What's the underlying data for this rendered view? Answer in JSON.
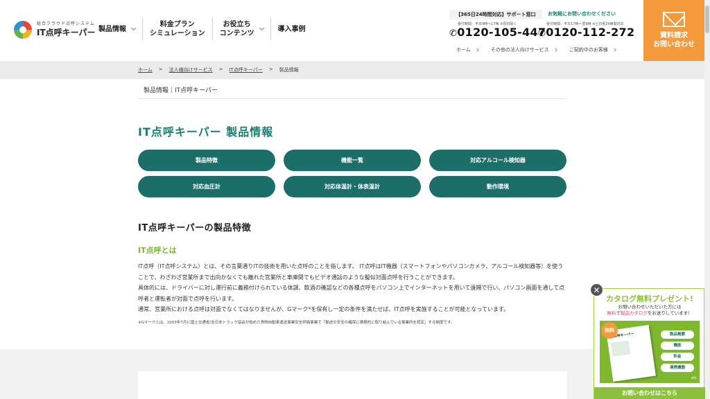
{
  "header": {
    "logo_sub": "総合クラウド点呼システム",
    "logo_main": "IT点呼キーパー",
    "nav": [
      {
        "label": "製品情報"
      },
      {
        "label_line1": "料金プラン",
        "label_line2": "シミュレーション"
      },
      {
        "label_line1": "お役立ち",
        "label_line2": "コンテンツ"
      },
      {
        "label": "導入事例"
      }
    ],
    "support_label": "【365日24時間対応】サポート窓口",
    "support_cta": "お気軽にお問い合わせください",
    "tel1_note": "受付時間：平日9時〜17時 ※祝日除く",
    "tel1_number": "0120-105-447",
    "tel2_note": "受付時間：平日17時〜翌9時 ※土日祝24時間対応",
    "tel2_number": "0120-112-272",
    "sub_links": [
      "ホーム",
      "その他の法人向けサービス",
      "ご契約中のお客様"
    ],
    "contact_line1": "資料請求",
    "contact_line2": "お問い合わせ"
  },
  "breadcrumb": {
    "items": [
      "ホーム",
      "法人様向けサービス",
      "IT点呼キーパー"
    ],
    "current": "製品情報",
    "separator": ">"
  },
  "page": {
    "subtitle": "製品情報｜IT点呼キーパー",
    "title": "IT点呼キーパー 製品情報",
    "buttons": [
      "製品特徴",
      "機能一覧",
      "対応アルコール検知器",
      "対応血圧計",
      "対応体温計・体表温計",
      "動作環境"
    ],
    "section_heading": "IT点呼キーパーの製品特徴",
    "sub_heading": "IT点呼とは",
    "paragraphs": [
      "IT点呼（IT点呼システム）とは、その言葉通りITの技術を用いた点呼のことを指します。 IT点呼はIT機器（スマートフォンやパソコンカメラ、アルコール検知器等）を使うことで、わざわざ営業所まで出向かなくても離れた営業所と車庫間でもビデオ通話のような擬似対面点呼を行うことができます。",
      "具体的には、ドライバーに対し運行前に義務付けられている体調、飲酒の確認などの各種点呼をパソコン上でインターネットを用いて遠隔で行い、パソコン画面を通して点呼者と運転者が対面で点呼を行います。",
      "通常、営業所における点呼は対面でなくてはなりませんが、Gマーク*を保有し一定の条件を満たせば、IT点呼を実施することが可能となっています。"
    ],
    "note": "※Gマークとは、2003年7月に国土交通省/全日本トラック協会が始めた貨物自動車運送事業安全評価事業で「輸送の安全の確保に積極的に取り組んでいる事業所を認定」する制度です。"
  },
  "catalog": {
    "close": "✕",
    "title": "カタログ無料プレゼント!",
    "desc_line1": "お問い合わせいただいた方には",
    "desc_em1": "無料",
    "desc_mid": "で",
    "desc_em2": "製品カタログ",
    "desc_end": "をお送りしています！",
    "badge": "無料",
    "book_title": "IT点呼キーパー",
    "tags": [
      "製品概要",
      "機能",
      "料金",
      "連携機器"
    ],
    "etc": "etc",
    "button": "お問い合わせはこちら"
  },
  "colors": {
    "accent": "#1c6f68",
    "title_green": "#1a7f72",
    "lime": "#8cc03d",
    "orange": "#f39a3c"
  }
}
